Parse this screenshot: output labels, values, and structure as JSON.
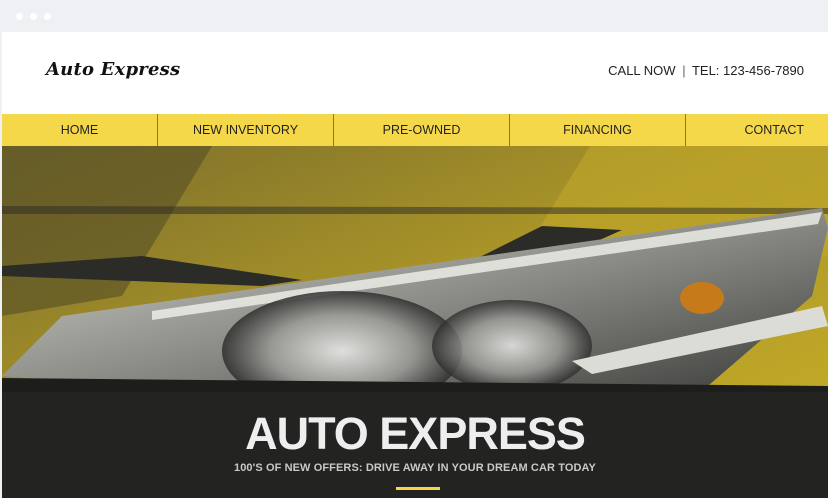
{
  "window": {
    "controls": [
      "dot",
      "dot",
      "dot"
    ]
  },
  "brand": {
    "logo_text": "Auto Express"
  },
  "contact": {
    "call_label": "CALL NOW",
    "separator": "|",
    "tel_text": "TEL: 123-456-7890"
  },
  "nav": {
    "items": [
      {
        "label": "HOME"
      },
      {
        "label": "NEW INVENTORY"
      },
      {
        "label": "PRE-OWNED"
      },
      {
        "label": "FINANCING"
      },
      {
        "label": "CONTACT"
      }
    ]
  },
  "hero": {
    "title": "AUTO EXPRESS",
    "subtitle": "100'S OF NEW OFFERS: DRIVE AWAY IN YOUR DREAM CAR TODAY",
    "image": "car-headlight-photo"
  },
  "colors": {
    "accent": "#f5d84a",
    "background": "#eef0f3"
  }
}
